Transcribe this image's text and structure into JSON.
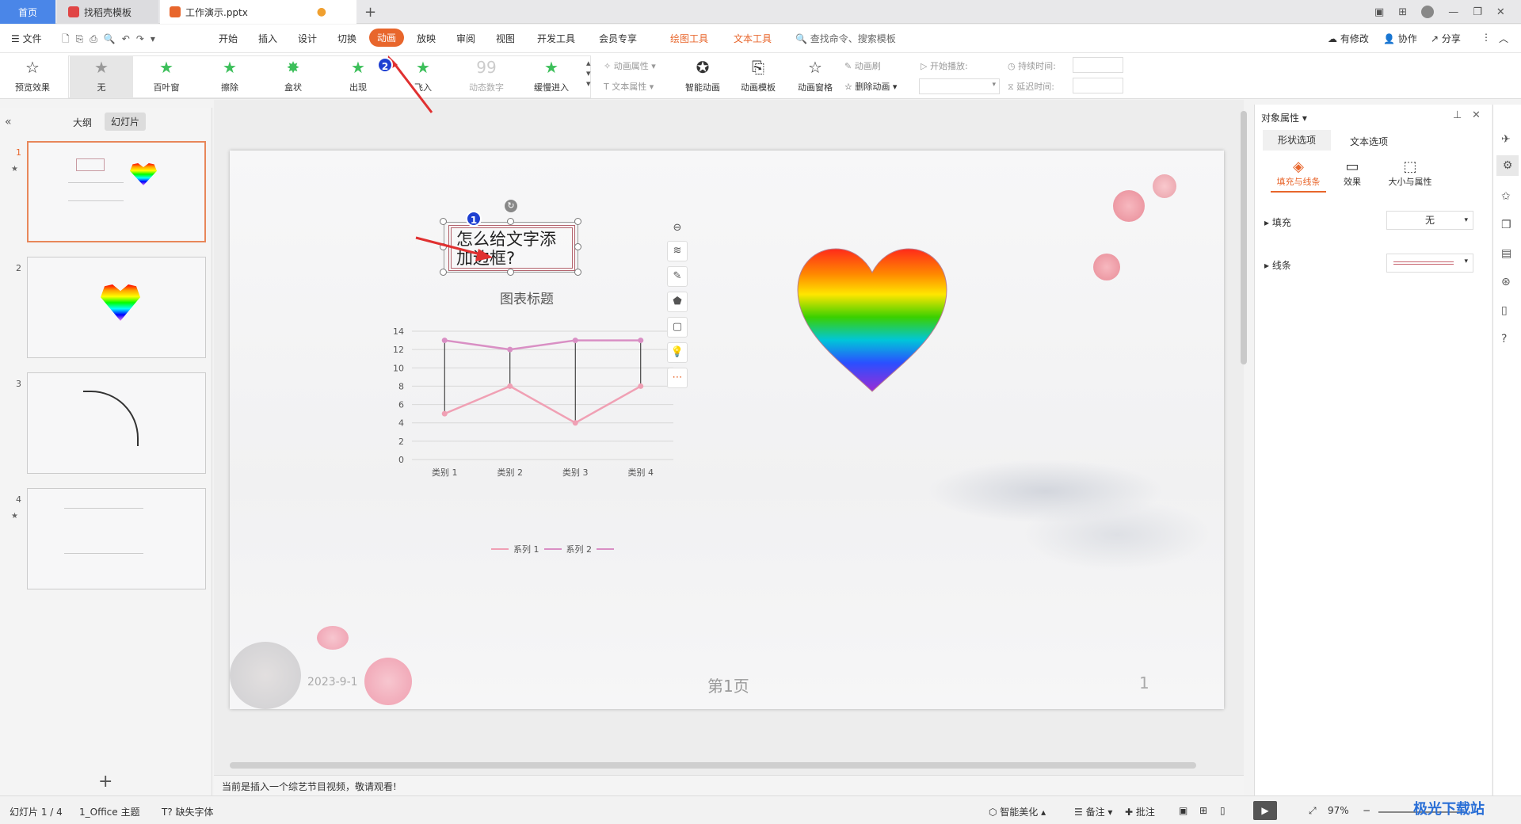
{
  "tabs": {
    "home": "首页",
    "template": "找稻壳模板",
    "doc": "工作演示.pptx",
    "add": "+"
  },
  "menu": {
    "file": "文件",
    "items": [
      "开始",
      "插入",
      "设计",
      "切换",
      "动画",
      "放映",
      "审阅",
      "视图",
      "开发工具",
      "会员专享"
    ],
    "tool1": "绘图工具",
    "tool2": "文本工具",
    "search": "查找命令、搜索模板",
    "modify": "有修改",
    "collab": "协作",
    "share": "分享"
  },
  "ribbon": {
    "preview": "预览效果",
    "effects": [
      "无",
      "百叶窗",
      "擦除",
      "盒状",
      "出现",
      "飞入",
      "动态数字",
      "缓慢进入"
    ],
    "anim_prop": "动画属性",
    "text_prop": "文本属性",
    "smart": "智能动画",
    "template": "动画模板",
    "pane": "动画窗格",
    "brush": "动画刷",
    "delete": "删除动画",
    "start": "开始播放:",
    "duration": "持续时间:",
    "delay": "延迟时间:"
  },
  "leftpane": {
    "outline": "大纲",
    "slides": "幻灯片",
    "nums": [
      "1",
      "2",
      "3",
      "4"
    ],
    "add": "+"
  },
  "slide": {
    "textbox": "怎么给文字添加边框?",
    "date": "2023-9-1",
    "page_label": "第1页",
    "page_num": "1"
  },
  "chart_data": {
    "type": "line",
    "title": "图表标题",
    "categories": [
      "类别 1",
      "类别 2",
      "类别 3",
      "类别 4"
    ],
    "series": [
      {
        "name": "系列 1",
        "values": [
          5,
          8,
          4,
          8
        ],
        "color": "#f0a0b4"
      },
      {
        "name": "系列 2",
        "values": [
          13,
          12,
          13,
          13
        ],
        "color": "#d98fc4"
      }
    ],
    "ylim": [
      0,
      14
    ],
    "yticks": [
      "0",
      "2",
      "4",
      "6",
      "8",
      "10",
      "12",
      "14"
    ],
    "high_low_lines": true
  },
  "rightpane": {
    "title": "对象属性",
    "tab_shape": "形状选项",
    "tab_text": "文本选项",
    "sub1": "填充与线条",
    "sub2": "效果",
    "sub3": "大小与属性",
    "fill": "填充",
    "fill_value": "无",
    "line": "线条"
  },
  "notes": "当前是插入一个综艺节目视频，敬请观看!",
  "status": {
    "slide": "幻灯片 1 / 4",
    "theme": "1_Office 主题",
    "font": "缺失字体",
    "beautify": "智能美化",
    "notes": "备注",
    "comment": "批注",
    "zoom": "97%"
  },
  "watermark": "极光下载站",
  "accent": "#e8875a",
  "badges": [
    "1",
    "2"
  ]
}
